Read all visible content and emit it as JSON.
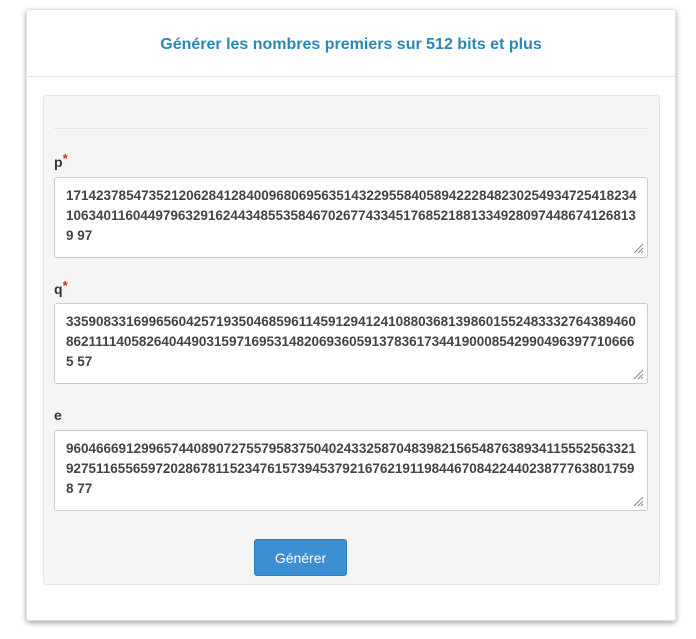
{
  "header": {
    "title": "Générer les nombres premiers sur 512 bits et plus"
  },
  "fields": {
    "p": {
      "label": "p",
      "required_mark": "*",
      "value": "171423785473521206284128400968069563514322955840589422284823025493472541823410634011604497963291624434855358467026774334517685218813349280974486741268139 97"
    },
    "q": {
      "label": "q",
      "required_mark": "*",
      "value": "335908331699656042571935046859611459129412410880368139860155248333276438946086211114058264044903159716953148206936059137836173441900085429904963977106665 57"
    },
    "e": {
      "label": "e",
      "value": "960466691299657440890727557958375040243325870483982156548763893411555256332192751165565972028678115234761573945379216762191198446708422440238777638017598 77"
    }
  },
  "actions": {
    "generate_label": "Générer"
  },
  "colors": {
    "title": "#2a87b8",
    "button": "#3c8fd2",
    "required": "#c9302c"
  }
}
